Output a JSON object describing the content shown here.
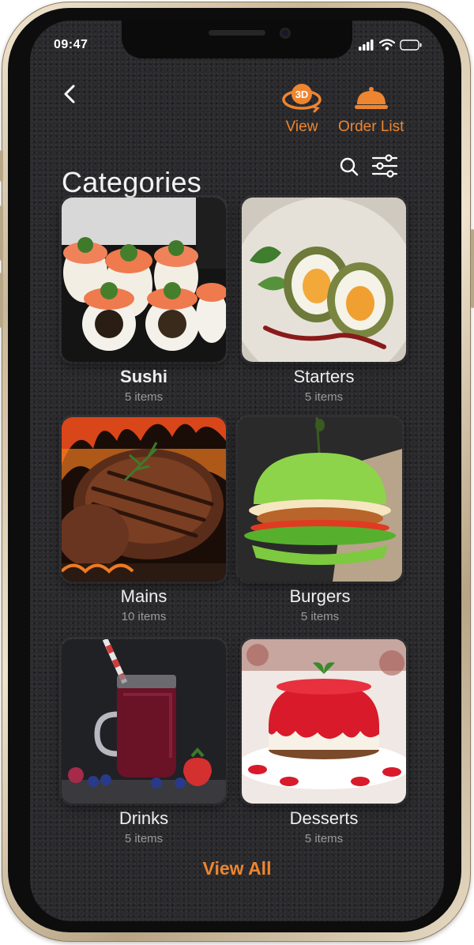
{
  "status_bar": {
    "time": "09:47"
  },
  "header": {
    "view_label": "View",
    "view_badge": "3D",
    "order_list_label": "Order List",
    "accent_color": "#ee8530"
  },
  "page": {
    "title": "Categories"
  },
  "categories": [
    {
      "name": "Sushi",
      "count": "5 items",
      "icon": "sushi-photo"
    },
    {
      "name": "Starters",
      "count": "5 items",
      "icon": "scotch-egg-photo"
    },
    {
      "name": "Mains",
      "count": "10 items",
      "icon": "grilled-steak-photo"
    },
    {
      "name": "Burgers",
      "count": "5 items",
      "icon": "green-burger-photo"
    },
    {
      "name": "Drinks",
      "count": "5 items",
      "icon": "berry-smoothie-photo"
    },
    {
      "name": "Desserts",
      "count": "5 items",
      "icon": "red-jelly-cake-photo"
    }
  ],
  "footer": {
    "view_all_label": "View All"
  }
}
